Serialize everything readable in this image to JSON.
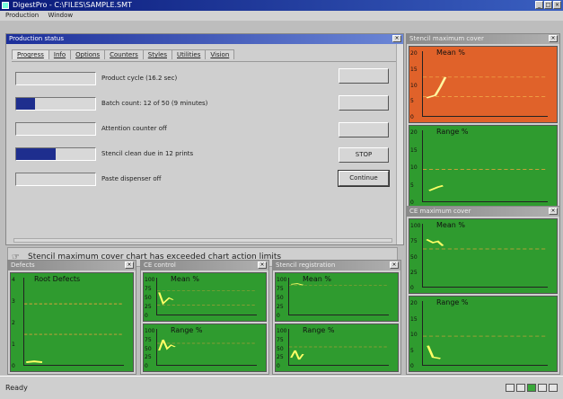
{
  "window": {
    "title": "DigestPro - C:\\FILES\\SAMPLE.SMT"
  },
  "menu": [
    "Production",
    "Window"
  ],
  "production": {
    "title": "Production status",
    "tabs": [
      "Progress",
      "Info",
      "Options",
      "Counters",
      "Styles",
      "Utilities",
      "Vision"
    ],
    "rows": [
      {
        "label": "Product cycle (16.2 sec)",
        "progress": 0.0
      },
      {
        "label": "Batch count: 12 of 50 (9 minutes)",
        "progress": 0.24
      },
      {
        "label": "Attention counter off",
        "progress": 0.0
      },
      {
        "label": "Stencil clean due in 12 prints",
        "progress": 0.5
      },
      {
        "label": "Paste dispenser off",
        "progress": 0.0
      }
    ],
    "buttons": [
      "",
      "",
      "",
      "STOP",
      "Continue"
    ]
  },
  "message": "Stencil maximum cover chart has exceeded chart action limits",
  "charts": {
    "stencil_top": {
      "title": "Stencil maximum cover",
      "series": "Mean %",
      "yticks": [
        "20",
        "15",
        "10",
        "5",
        "0"
      ]
    },
    "stencil_bottom": {
      "series": "Range %",
      "yticks": [
        "20",
        "15",
        "10",
        "5",
        "0"
      ]
    },
    "ce_top": {
      "title": "CE maximum cover",
      "series": "Mean %",
      "yticks": [
        "100",
        "75",
        "50",
        "25",
        "0"
      ]
    },
    "ce_bottom": {
      "series": "Range %",
      "yticks": [
        "20",
        "15",
        "10",
        "5",
        "0"
      ]
    },
    "defects": {
      "title": "Defects",
      "series": "Root Defects",
      "yticks": [
        "4",
        "3",
        "2",
        "1",
        "0"
      ]
    },
    "ce_control_top": {
      "title": "CE control",
      "series": "Mean %",
      "yticks": [
        "100",
        "75",
        "50",
        "25",
        "0"
      ]
    },
    "ce_control_bottom": {
      "series": "Range %",
      "yticks": [
        "100",
        "75",
        "50",
        "25",
        "0"
      ]
    },
    "stencil_registration_top": {
      "title": "Stencil registration",
      "series": "Mean %",
      "yticks": [
        "100",
        "75",
        "50",
        "25",
        "0"
      ]
    },
    "stencil_registration_bottom": {
      "series": "Range %",
      "yticks": [
        "100",
        "75",
        "50",
        "25",
        "0"
      ]
    }
  },
  "status": {
    "text": "Ready"
  }
}
